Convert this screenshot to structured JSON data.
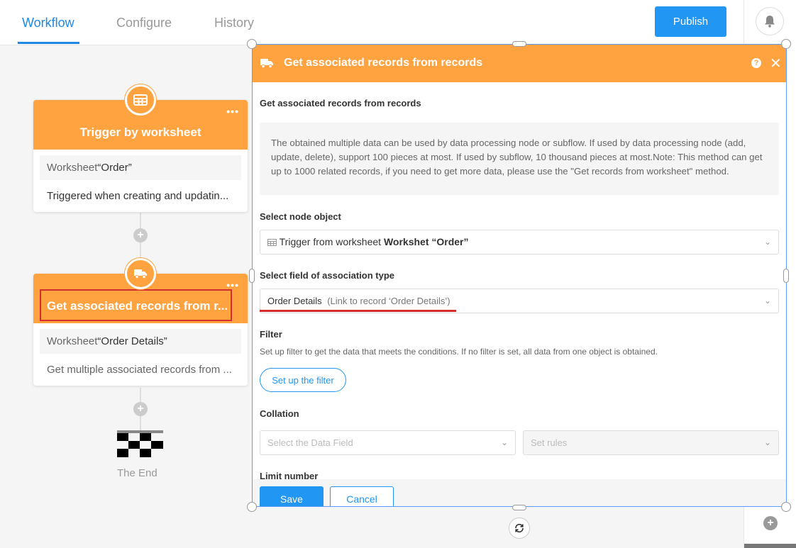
{
  "nav": {
    "tabs": [
      {
        "label": "Workflow",
        "active": true
      },
      {
        "label": "Configure",
        "active": false
      },
      {
        "label": "History",
        "active": false
      }
    ],
    "publish_label": "Publish",
    "accent": "#1e88e5"
  },
  "flow": {
    "trigger": {
      "title": "Trigger by worksheet",
      "row1_prefix": "Worksheet",
      "row1_value": "“Order”",
      "row2": "Triggered when creating and updatin..."
    },
    "step": {
      "title": "Get associated records from r...",
      "row1_prefix": "Worksheet",
      "row1_value": "“Order Details”",
      "row2": "Get multiple associated records from ..."
    },
    "end_label": "The End",
    "node_color": "#ffa340"
  },
  "panel": {
    "header_title": "Get associated records from records",
    "section_title": "Get associated records from records",
    "description": "The obtained multiple data can be used by data processing node or subflow. If used by data processing node (add, update, delete), support 100 pieces at most. If used by subflow, 10 thousand pieces at most.Note: This method can get up to 1000 related records, if you need to get more data, please use the \"Get records from worksheet\" method.",
    "node_object_label": "Select node object",
    "node_object_prefix": "Trigger from worksheet",
    "node_object_value": "Workshet “Order”",
    "assoc_label": "Select field of association type",
    "assoc_value": "Order Details",
    "assoc_detail": "(Link to record ‘Order Details’)",
    "filter_label": "Filter",
    "filter_hint": "Set up filter to get the data that meets the conditions. If no filter is set, all data from one object is obtained.",
    "filter_button": "Set up the filter",
    "collation_label": "Collation",
    "collation_field_placeholder": "Select the Data Field",
    "collation_rules_placeholder": "Set rules",
    "limit_label": "Limit number",
    "save_label": "Save",
    "cancel_label": "Cancel"
  }
}
